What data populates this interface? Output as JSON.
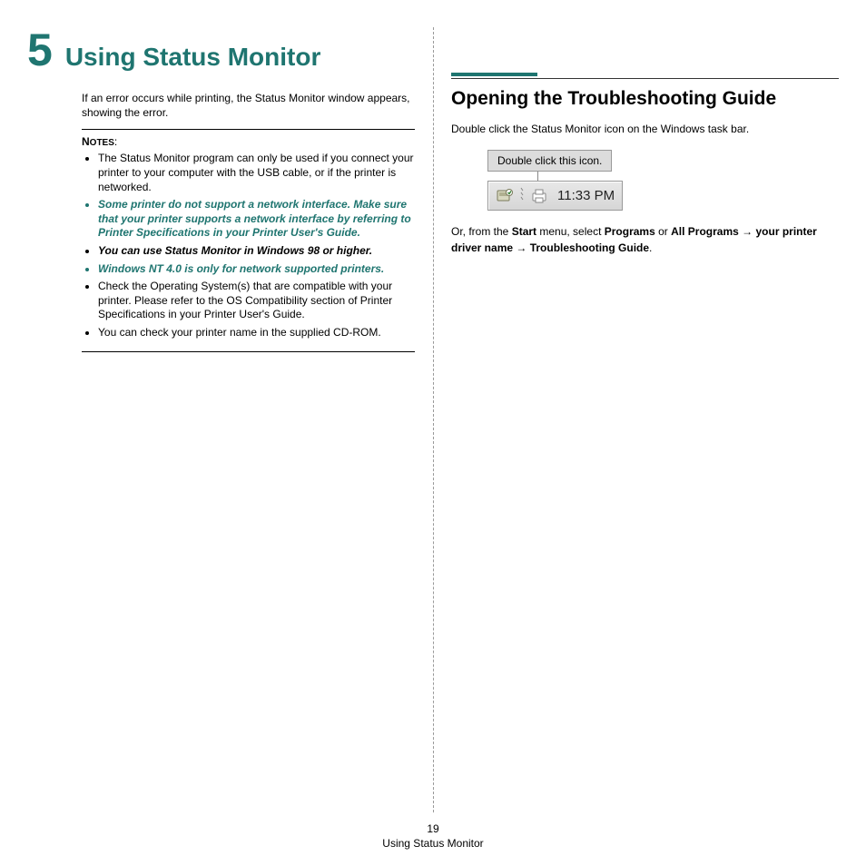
{
  "chapter": {
    "number": "5",
    "title": "Using Status Monitor"
  },
  "intro": "If an error occurs while printing, the Status Monitor window appears, showing the error.",
  "notes": {
    "label_big": "N",
    "label_small": "OTES",
    "colon": ":",
    "items": {
      "n1": "The Status Monitor program can only be used if you connect your printer to your computer with the USB cable, or if the printer is networked.",
      "n2": "Some printer do not support a network interface. Make sure that your printer supports a network interface by referring to Printer Specifications in your Printer User's Guide.",
      "n3": "You can use Status Monitor in Windows 98 or higher.",
      "n4": "Windows NT 4.0 is only for network supported printers.",
      "n5": "Check the Operating System(s) that are compatible with your printer. Please refer to the OS Compatibility section of Printer Specifications in your Printer User's Guide.",
      "n6": "You can check your printer name in the supplied CD-ROM."
    }
  },
  "right": {
    "title": "Opening the Troubleshooting Guide",
    "p1": "Double click the Status Monitor icon on the Windows task bar.",
    "callout": "Double click this icon.",
    "time": "11:33 PM",
    "seq": {
      "pre": "Or, from the ",
      "start": "Start",
      "mid1": " menu, select ",
      "programs": "Programs",
      "or": " or ",
      "allprograms": "All Programs",
      "arrow": " → ",
      "driver": "your printer driver name",
      "arrow2": " → ",
      "tsg": "Troubleshooting Guide",
      "end": "."
    }
  },
  "footer": {
    "page": "19",
    "title": "Using Status Monitor"
  }
}
